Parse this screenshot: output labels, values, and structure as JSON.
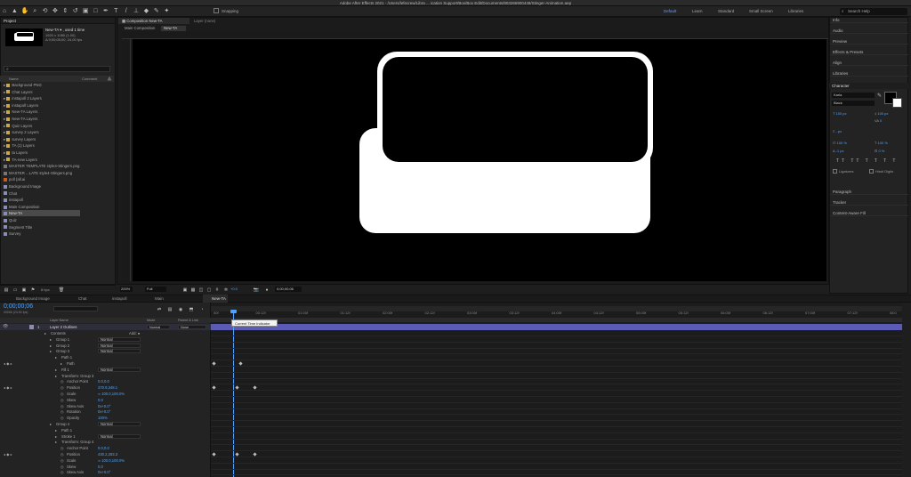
{
  "app_title": "Adobe After Effects 2021 - /Users/lefecrew/Libra ... ication Support/Box/Box Edit/Documents/803266900448/Stinger-Animation.aep",
  "toolbar": {
    "snapping_label": "Snapping",
    "workspaces": [
      "Default",
      "Learn",
      "Standard",
      "Small Screen",
      "Libraries"
    ],
    "active_workspace": "Default",
    "search_placeholder": "Search Help"
  },
  "project_panel": {
    "title": "Project",
    "selected_name": "New-TA ▾ , used 1 time",
    "selected_info_1": "1920 x 1080 (1.00)",
    "selected_info_2": "Δ 0;00;05;00, 24.00 fps",
    "search_placeholder": "",
    "col_name": "Name",
    "col_comment": "Comment",
    "items": [
      {
        "label": "Background PNG",
        "type": "folder"
      },
      {
        "label": "Chat Layers",
        "type": "folder"
      },
      {
        "label": "instapoll 2 Layers",
        "type": "folder"
      },
      {
        "label": "instapoll Layers",
        "type": "folder"
      },
      {
        "label": "New-TA Layers",
        "type": "folder"
      },
      {
        "label": "New-TA Layers",
        "type": "folder"
      },
      {
        "label": "Quiz Layers",
        "type": "folder"
      },
      {
        "label": "survey 2 Layers",
        "type": "folder"
      },
      {
        "label": "survey Layers",
        "type": "folder"
      },
      {
        "label": "TA (1) Layers",
        "type": "folder"
      },
      {
        "label": "ta Layers",
        "type": "folder"
      },
      {
        "label": "TA-new Layers",
        "type": "folder"
      },
      {
        "label": "MASTER TEMPLATE style4-Stingers.png",
        "type": "img"
      },
      {
        "label": "MASTER ...LATE style4-Stingers.png",
        "type": "img"
      },
      {
        "label": "poll (all.ai",
        "type": "ai"
      },
      {
        "label": "Background Image",
        "type": "comp"
      },
      {
        "label": "Chat",
        "type": "comp"
      },
      {
        "label": "instapoll",
        "type": "comp"
      },
      {
        "label": "Main Composition",
        "type": "comp"
      },
      {
        "label": "New-TA",
        "type": "comp"
      },
      {
        "label": "Quiz",
        "type": "comp"
      },
      {
        "label": "Segment Title",
        "type": "comp"
      },
      {
        "label": "Survey",
        "type": "comp"
      }
    ],
    "bpc": "8 bpc",
    "selected_index": 19
  },
  "composition_panel": {
    "tab_label": "Composition New-TA",
    "layer_tab": "Layer (none)",
    "breadcrumb_1": "Main Composition",
    "breadcrumb_2": "New-TA",
    "zoom": "200%",
    "quality": "Full",
    "exposure": "+0.0",
    "timecode": "0;00;00;06"
  },
  "right_panels": {
    "items": [
      "Info",
      "Audio",
      "Preview",
      "Effects & Presets",
      "Align",
      "Libraries"
    ],
    "character_title": "Character",
    "font_name": "Karla",
    "font_style": "Black",
    "font_size": "100 px",
    "leading": "100 px",
    "tracking": "0",
    "stroke_unit": "- px",
    "vscale": "100 %",
    "hscale": "100 %",
    "baseline": "-1 px",
    "tsume": "0 %",
    "ligatures_label": "Ligatures",
    "hindi_label": "Hindi Digits",
    "bottom_items": [
      "Paragraph",
      "Tracker",
      "Content-Aware Fill"
    ]
  },
  "timeline": {
    "tabs": [
      "Background Image",
      "Chat",
      "instapoll",
      "Main Composition",
      "New-TA"
    ],
    "active_tab": "New-TA",
    "current_time": "0;00;00;06",
    "current_frames": "00006 (24.00 fps)",
    "col_layer_name": "Layer Name",
    "col_mode": "Mode",
    "col_parent": "Parent & Link",
    "layer_num": "1",
    "layer_name": "Layer 2 Outlines",
    "layer_mode": "Normal",
    "parent_value": "None",
    "tooltip": "Current Time Indicator",
    "time_marks": [
      "00f",
      "00:12f",
      "01:00f",
      "01:12f",
      "02:00f",
      "02:12f",
      "03:00f",
      "03:12f",
      "04:00f",
      "04:12f",
      "05:00f",
      "05:12f",
      "06:00f",
      "06:12f",
      "07:00f",
      "07:12f",
      "08:0"
    ],
    "rows": [
      {
        "label": "Contents",
        "indent": 1,
        "extra": "Add: ●"
      },
      {
        "label": "Group 1",
        "indent": 2,
        "mode": "Normal"
      },
      {
        "label": "Group 2",
        "indent": 2,
        "mode": "Normal"
      },
      {
        "label": "Group 3",
        "indent": 2,
        "mode": "Normal"
      },
      {
        "label": "Path 1",
        "indent": 3
      },
      {
        "label": "Path",
        "indent": 4,
        "stopwatch": true
      },
      {
        "label": "Fill 1",
        "indent": 3,
        "mode": "Normal"
      },
      {
        "label": "Transform: Group 3",
        "indent": 3
      },
      {
        "label": "Anchor Point",
        "indent": 4,
        "value": "0.0,0.0"
      },
      {
        "label": "Position",
        "indent": 4,
        "value": "370.9,348.1",
        "stopwatch": true
      },
      {
        "label": "Scale",
        "indent": 4,
        "value": "∞ 100.0,100.0%"
      },
      {
        "label": "Skew",
        "indent": 4,
        "value": "0.0"
      },
      {
        "label": "Skew Axis",
        "indent": 4,
        "value": "0x+0.0°"
      },
      {
        "label": "Rotation",
        "indent": 4,
        "value": "0x+0.0°"
      },
      {
        "label": "Opacity",
        "indent": 4,
        "value": "100%"
      },
      {
        "label": "Group 4",
        "indent": 2,
        "mode": "Normal"
      },
      {
        "label": "Path 1",
        "indent": 3
      },
      {
        "label": "Stroke 1",
        "indent": 3,
        "mode": "Normal"
      },
      {
        "label": "Transform: Group 4",
        "indent": 3
      },
      {
        "label": "Anchor Point",
        "indent": 4,
        "value": "0.0,0.0"
      },
      {
        "label": "Position",
        "indent": 4,
        "value": "430.2,283.3",
        "stopwatch": true
      },
      {
        "label": "Scale",
        "indent": 4,
        "value": "∞ 100.0,100.0%"
      },
      {
        "label": "Skew",
        "indent": 4,
        "value": "0.0"
      },
      {
        "label": "Skew Axis",
        "indent": 4,
        "value": "0x+0.0°"
      }
    ],
    "toggle_label": "Toggle Switches / Modes"
  },
  "colors": {
    "accent": "#4da3ff",
    "layer_bar": "#5b5bb6",
    "label_purple": "#8b8bb7"
  }
}
